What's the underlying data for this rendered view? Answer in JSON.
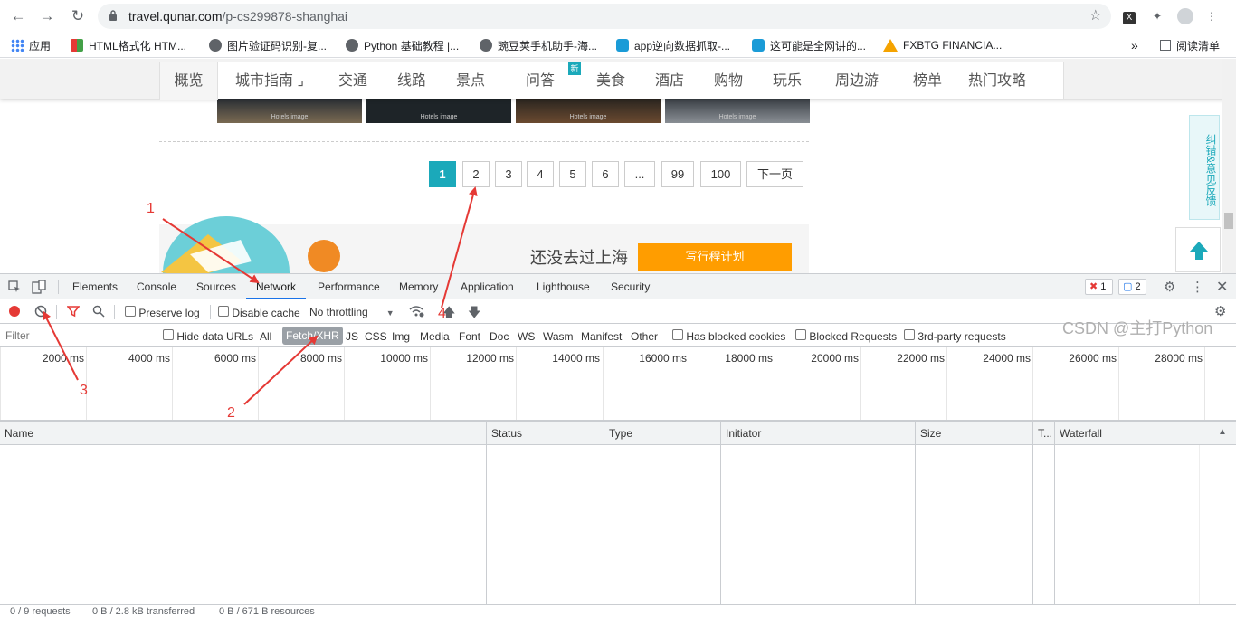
{
  "browser": {
    "url_host": "travel.qunar.com",
    "url_path": "/p-cs299878-shanghai",
    "bookmarks": [
      "应用",
      "HTML格式化 HTM...",
      "图片验证码识别-复...",
      "Python 基础教程 |...",
      "豌豆荚手机助手-海...",
      "app逆向数据抓取-...",
      "这可能是全网讲的...",
      "FXBTG FINANCIA..."
    ],
    "more": "»",
    "reading_list": "阅读清单"
  },
  "site": {
    "nav": [
      "概览",
      "城市指南 ⌟",
      "交通",
      "线路",
      "景点",
      "问答",
      "美食",
      "酒店",
      "购物",
      "玩乐",
      "周边游",
      "榜单",
      "热门攻略"
    ],
    "new_badge": "新",
    "pages": [
      "1",
      "2",
      "3",
      "4",
      "5",
      "6",
      "...",
      "99",
      "100",
      "下一页"
    ],
    "banner_text": "还没去过上海",
    "plan_button": "写行程计划",
    "feedback": "纠错&意见反馈"
  },
  "devtools": {
    "tabs": [
      "Elements",
      "Console",
      "Sources",
      "Network",
      "Performance",
      "Memory",
      "Application",
      "Lighthouse",
      "Security"
    ],
    "error_count": "1",
    "message_count": "2",
    "preserve_log": "Preserve log",
    "disable_cache": "Disable cache",
    "throttling": "No throttling",
    "filter_placeholder": "Filter",
    "hide_data_urls": "Hide data URLs",
    "types": [
      "All",
      "Fetch/XHR",
      "JS",
      "CSS",
      "Img",
      "Media",
      "Font",
      "Doc",
      "WS",
      "Wasm",
      "Manifest",
      "Other"
    ],
    "has_blocked_cookies": "Has blocked cookies",
    "blocked_requests": "Blocked Requests",
    "third_party": "3rd-party requests",
    "ticks": [
      "2000 ms",
      "4000 ms",
      "6000 ms",
      "8000 ms",
      "10000 ms",
      "12000 ms",
      "14000 ms",
      "16000 ms",
      "18000 ms",
      "20000 ms",
      "22000 ms",
      "24000 ms",
      "26000 ms",
      "28000 ms"
    ],
    "columns": [
      "Name",
      "Status",
      "Type",
      "Initiator",
      "Size",
      "T...",
      "Waterfall"
    ],
    "status": [
      "0 / 9 requests",
      "0 B / 2.8 kB transferred",
      "0 B / 671 B resources"
    ]
  },
  "annotations": [
    "1",
    "2",
    "3",
    "4"
  ],
  "watermark": "CSDN @主打Python",
  "colors": {
    "accent": "#1ba9ba",
    "orange": "#ff9d00",
    "annot": "#e53935",
    "devtools_active": "#1a73e8"
  }
}
